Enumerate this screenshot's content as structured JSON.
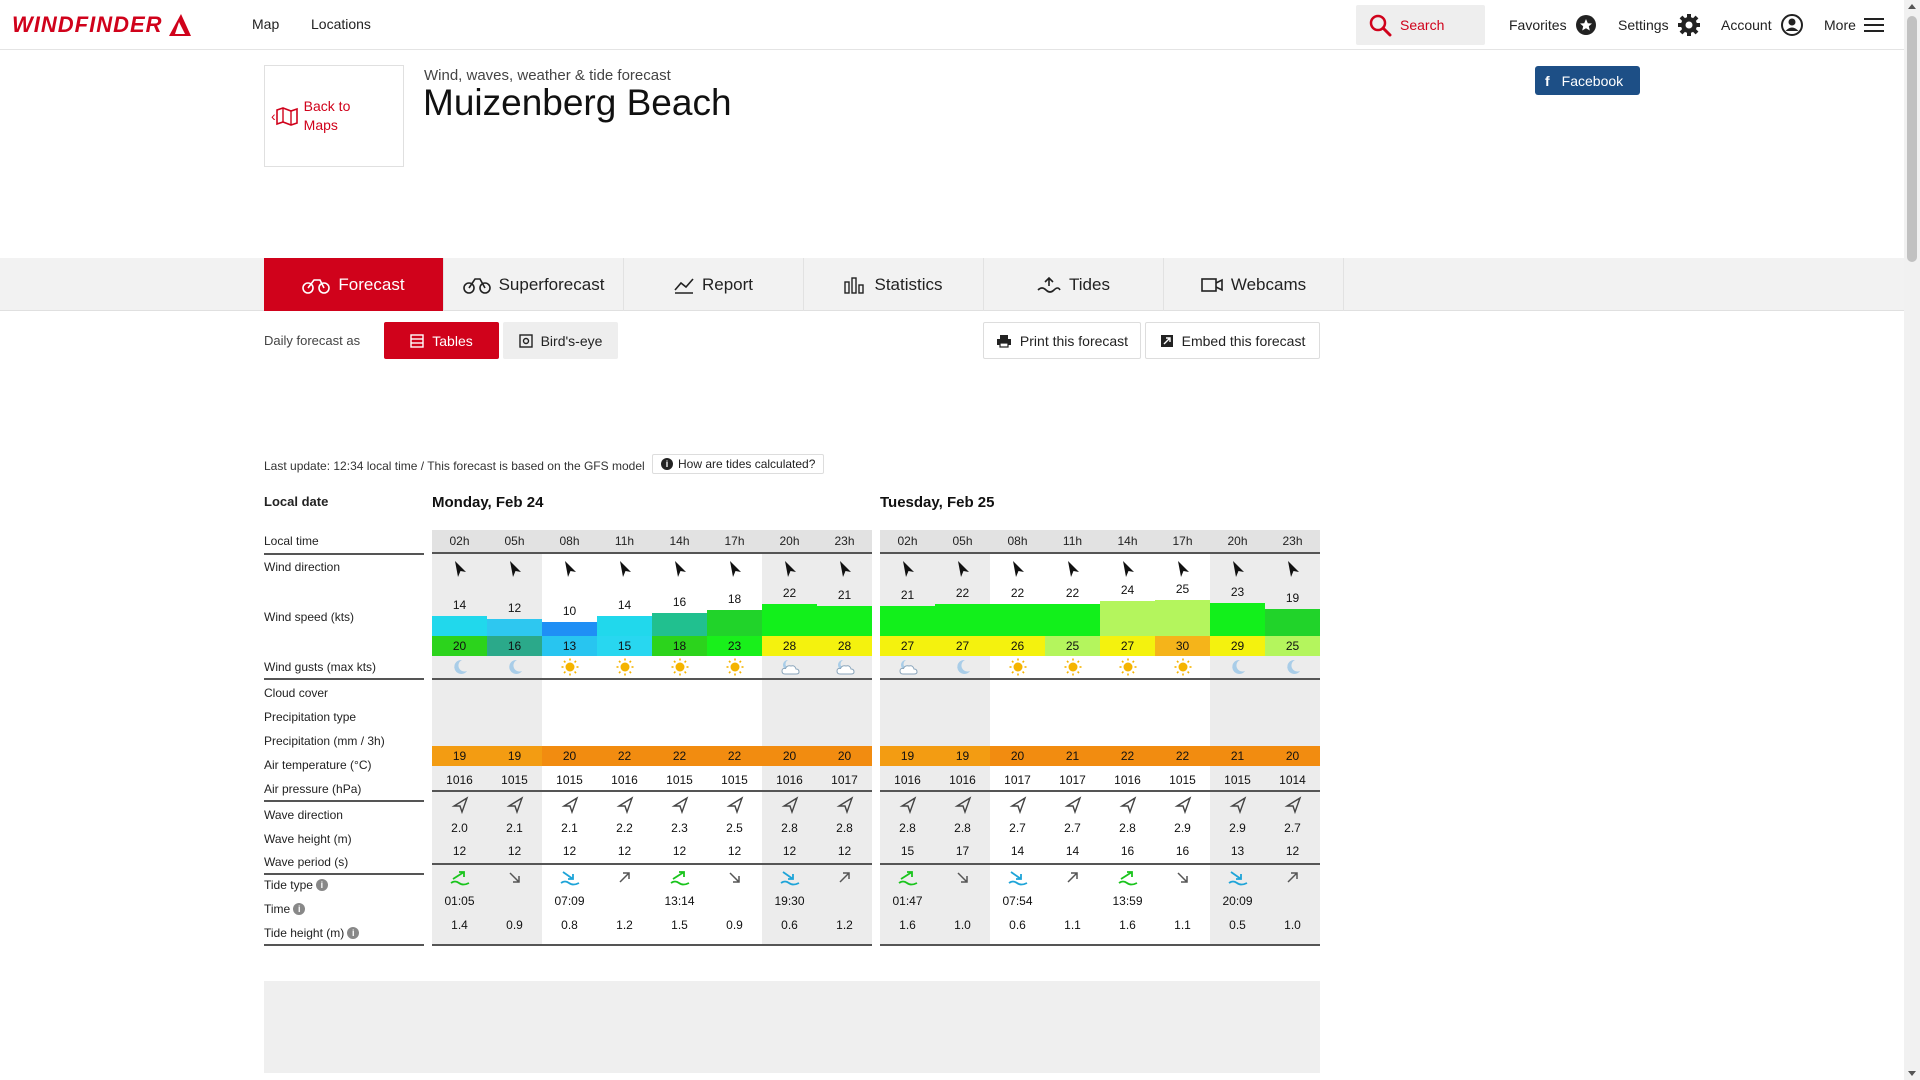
{
  "brand": {
    "logo_text": "WINDFINDER",
    "accent": "#d0021b"
  },
  "nav": {
    "map": "Map",
    "locations": "Locations"
  },
  "topbar": {
    "search": "Search",
    "favorites": "Favorites",
    "settings": "Settings",
    "account": "Account",
    "more": "More"
  },
  "header": {
    "back_label": "Back to Maps",
    "subtitle": "Wind, waves, weather & tide forecast",
    "title": "Muizenberg Beach",
    "facebook": "Facebook"
  },
  "tabs": [
    "Forecast",
    "Superforecast",
    "Report",
    "Statistics",
    "Tides",
    "Webcams"
  ],
  "controls": {
    "daily_label": "Daily forecast as",
    "tables": "Tables",
    "birds_eye": "Bird's-eye",
    "print": "Print this forecast",
    "embed": "Embed this forecast"
  },
  "info": {
    "last_update": "Last update: 12:34 local time / This forecast is based on the GFS model",
    "tides_question": "How are tides calculated?"
  },
  "table": {
    "local_date_label": "Local date",
    "row_labels": {
      "local_time": "Local time",
      "wind_direction": "Wind direction",
      "wind_speed": "Wind speed (kts)",
      "wind_gusts": "Wind gusts (max kts)",
      "cloud_cover": "Cloud cover",
      "precip_type": "Precipitation type",
      "precip": "Precipitation (mm / 3h)",
      "air_temp": "Air temperature (°C)",
      "air_pressure": "Air pressure (hPa)",
      "wave_direction": "Wave direction",
      "wave_height": "Wave height (m)",
      "wave_period": "Wave period (s)",
      "tide_type": "Tide type",
      "tide_time": "Time",
      "tide_height": "Tide height (m)"
    },
    "days": [
      {
        "label": "Monday, Feb 24",
        "hours": [
          "02h",
          "05h",
          "08h",
          "11h",
          "14h",
          "17h",
          "20h",
          "23h"
        ],
        "night": [
          true,
          true,
          false,
          false,
          false,
          false,
          true,
          true
        ],
        "wind_speed": [
          14,
          12,
          10,
          14,
          16,
          18,
          22,
          21
        ],
        "wind_speed_colors": [
          "#21d8ec",
          "#2ec7f0",
          "#1f8ff5",
          "#21d8ec",
          "#21c08f",
          "#21d32a",
          "#12f01b",
          "#12f01b"
        ],
        "wind_gusts": [
          20,
          16,
          13,
          15,
          18,
          23,
          28,
          28
        ],
        "wind_gusts_colors": [
          "#2cd31c",
          "#2ba98a",
          "#28c5f0",
          "#28d7f0",
          "#2cd31c",
          "#19f01b",
          "#f4f20e",
          "#f4f20e"
        ],
        "cloud": [
          "moon",
          "moon",
          "sun",
          "sun",
          "sun",
          "sun",
          "moon-cloud",
          "moon-cloud"
        ],
        "air_temp": [
          19,
          19,
          20,
          22,
          22,
          22,
          20,
          20
        ],
        "air_pressure": [
          1016,
          1015,
          1015,
          1016,
          1015,
          1015,
          1016,
          1017
        ],
        "wave_height": [
          "2.0",
          "2.1",
          "2.1",
          "2.2",
          "2.3",
          "2.5",
          "2.8",
          "2.8"
        ],
        "wave_period": [
          12,
          12,
          12,
          12,
          12,
          12,
          12,
          12
        ],
        "tide_type": [
          "high",
          "falling",
          "low",
          "rising",
          "high",
          "falling",
          "low",
          "rising"
        ],
        "tide_time": [
          "01:05",
          "",
          "07:09",
          "",
          "13:14",
          "",
          "19:30",
          ""
        ],
        "tide_height": [
          "1.4",
          "0.9",
          "0.8",
          "1.2",
          "1.5",
          "0.9",
          "0.6",
          "1.2"
        ]
      },
      {
        "label": "Tuesday, Feb 25",
        "hours": [
          "02h",
          "05h",
          "08h",
          "11h",
          "14h",
          "17h",
          "20h",
          "23h"
        ],
        "night": [
          true,
          true,
          false,
          false,
          false,
          false,
          true,
          true
        ],
        "wind_speed": [
          21,
          22,
          22,
          22,
          24,
          25,
          23,
          19
        ],
        "wind_speed_colors": [
          "#12f01b",
          "#12f01b",
          "#12f01b",
          "#12f01b",
          "#b4f55d",
          "#b4f55d",
          "#12f01b",
          "#21d32a"
        ],
        "wind_gusts": [
          27,
          27,
          26,
          25,
          27,
          30,
          29,
          25
        ],
        "wind_gusts_colors": [
          "#f4f20e",
          "#f4f20e",
          "#f4f20e",
          "#b4f55d",
          "#f4f20e",
          "#f5b41a",
          "#f4f20e",
          "#b4f55d"
        ],
        "cloud": [
          "moon-cloud",
          "moon",
          "sun",
          "sun",
          "sun",
          "sun",
          "moon",
          "moon"
        ],
        "air_temp": [
          19,
          19,
          20,
          21,
          22,
          22,
          21,
          20
        ],
        "air_pressure": [
          1016,
          1016,
          1017,
          1017,
          1016,
          1015,
          1015,
          1014
        ],
        "wave_height": [
          "2.8",
          "2.8",
          "2.7",
          "2.7",
          "2.8",
          "2.9",
          "2.9",
          "2.7"
        ],
        "wave_period": [
          15,
          17,
          14,
          14,
          16,
          16,
          13,
          12
        ],
        "tide_type": [
          "high",
          "falling",
          "low",
          "rising",
          "high",
          "falling",
          "low",
          "rising"
        ],
        "tide_time": [
          "01:47",
          "",
          "07:54",
          "",
          "13:59",
          "",
          "20:09",
          ""
        ],
        "tide_height": [
          "1.6",
          "1.0",
          "0.6",
          "1.1",
          "1.6",
          "1.1",
          "0.5",
          "1.0"
        ]
      }
    ],
    "temp_colors": {
      "19": "#f39c12",
      "20": "#f28c10",
      "21": "#f28c10",
      "22": "#f28c10"
    }
  }
}
